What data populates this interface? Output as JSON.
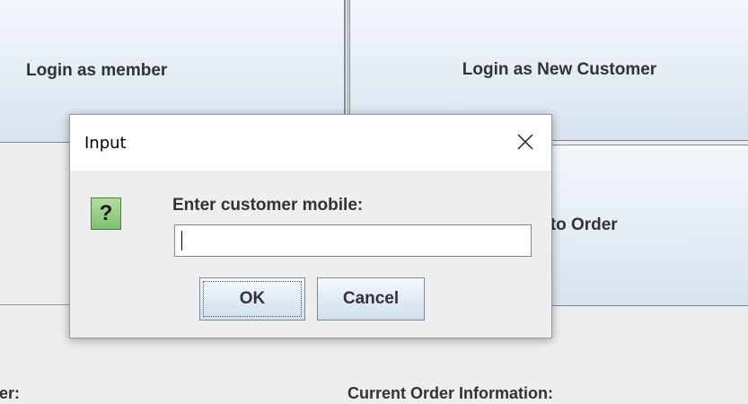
{
  "background": {
    "buttons": {
      "login_member": "Login as member",
      "login_new_customer": "Login as New Customer",
      "add_item": "em to Order"
    },
    "labels": {
      "left": "er:",
      "current_order": "Current Order Information:"
    }
  },
  "dialog": {
    "title": "Input",
    "close_icon": "close-icon",
    "question_icon": "question-icon",
    "question_glyph": "?",
    "prompt": "Enter customer mobile:",
    "input_value": "",
    "ok_label": "OK",
    "cancel_label": "Cancel"
  },
  "colors": {
    "button_gradient_top": "#f4f8fc",
    "button_gradient_bottom": "#d7e4f0",
    "button_border": "#7a8a99",
    "dialog_bg": "#eeeeee",
    "titlebar_bg": "#ffffff",
    "question_icon_green": "#7fbf6e"
  }
}
